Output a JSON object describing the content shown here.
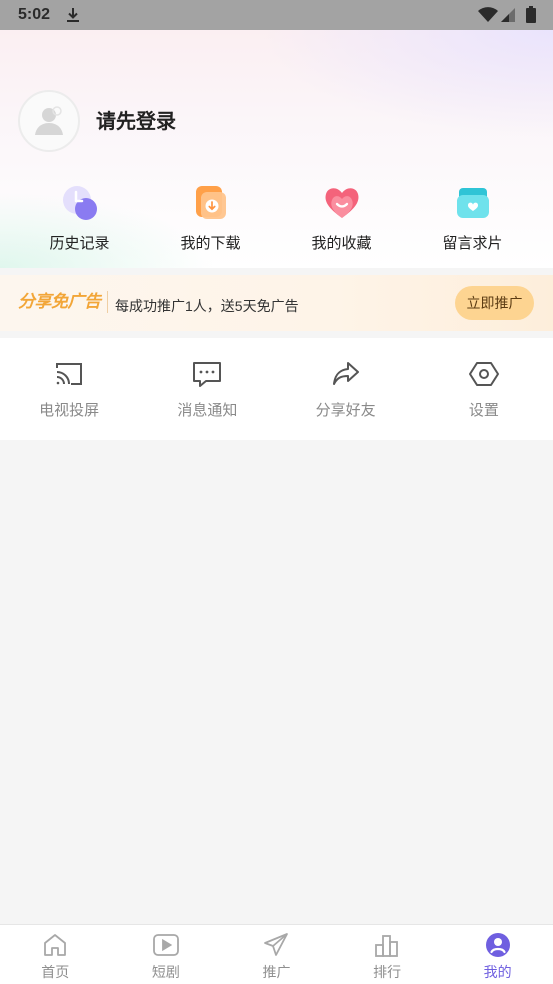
{
  "status_bar": {
    "time": "5:02",
    "icons": [
      "download-icon",
      "wifi-icon",
      "signal-icon",
      "battery-icon"
    ]
  },
  "profile": {
    "avatar_icon": "avatar-placeholder-icon",
    "login_prompt": "请先登录"
  },
  "quick_actions": [
    {
      "label": "历史记录",
      "icon": "history-icon"
    },
    {
      "label": "我的下载",
      "icon": "download-icon"
    },
    {
      "label": "我的收藏",
      "icon": "favorite-icon"
    },
    {
      "label": "留言求片",
      "icon": "request-icon"
    }
  ],
  "promo_banner": {
    "title": "分享免广告",
    "text": "每成功推广1人，送5天免广告",
    "button_label": "立即推广"
  },
  "functions": [
    {
      "label": "电视投屏",
      "icon": "cast-icon"
    },
    {
      "label": "消息通知",
      "icon": "message-icon"
    },
    {
      "label": "分享好友",
      "icon": "share-icon"
    },
    {
      "label": "设置",
      "icon": "settings-icon"
    }
  ],
  "bottom_nav": [
    {
      "label": "首页",
      "icon": "home-icon",
      "active": false
    },
    {
      "label": "短剧",
      "icon": "play-icon",
      "active": false
    },
    {
      "label": "推广",
      "icon": "send-icon",
      "active": false
    },
    {
      "label": "排行",
      "icon": "ranking-icon",
      "active": false
    },
    {
      "label": "我的",
      "icon": "profile-icon",
      "active": true
    }
  ],
  "colors": {
    "accent": "#6f5fe0",
    "banner_button": "#fdd491",
    "banner_title": "#f2a638",
    "status_bar": "#a3a3a3",
    "page_background": "#f5f5f5"
  }
}
